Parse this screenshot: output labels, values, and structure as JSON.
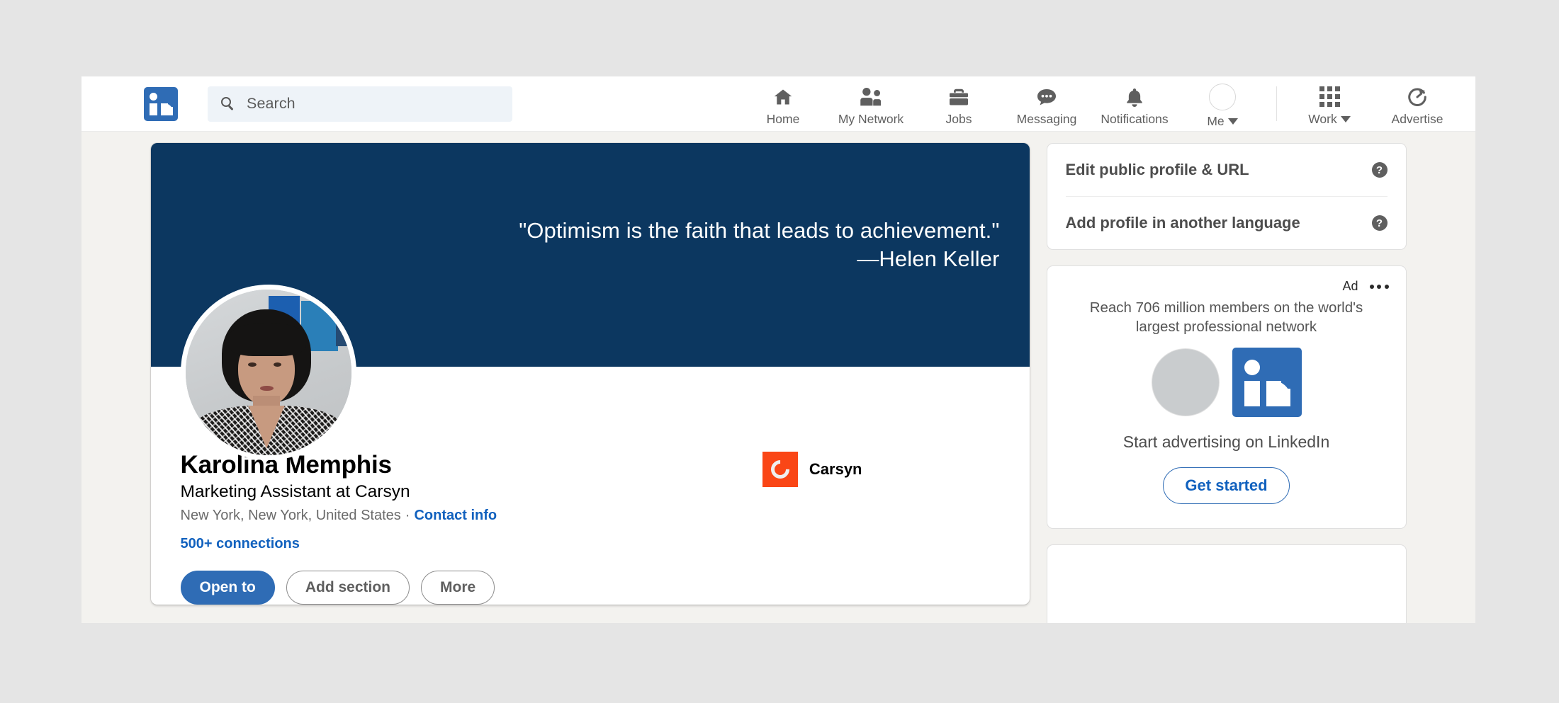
{
  "nav": {
    "logo_icon": "linkedin-logo-icon",
    "search": {
      "icon": "search-icon",
      "placeholder": "Search",
      "value": ""
    },
    "items": [
      {
        "label": "Home",
        "icon": "home-icon"
      },
      {
        "label": "My Network",
        "icon": "people-icon"
      },
      {
        "label": "Jobs",
        "icon": "briefcase-icon"
      },
      {
        "label": "Messaging",
        "icon": "chat-bubble-icon"
      },
      {
        "label": "Notifications",
        "icon": "bell-icon"
      },
      {
        "label": "Me",
        "icon": "avatar-icon",
        "caret": true
      }
    ],
    "secondary_items": [
      {
        "label": "Work",
        "icon": "grid-icon",
        "caret": true
      },
      {
        "label": "Advertise",
        "icon": "advertise-icon"
      }
    ]
  },
  "profile": {
    "banner": {
      "quote": "\"Optimism is the faith that leads to achievement.\"\n—Helen Keller",
      "background_color": "#0c3760"
    },
    "name": "Karolina Memphis",
    "headline": "Marketing Assistant at Carsyn",
    "location": "New York, New York, United States",
    "separator": "·",
    "contact_info_link": "Contact info",
    "connections": "500+ connections",
    "buttons": [
      {
        "label": "Open to",
        "style": "primary"
      },
      {
        "label": "Add section",
        "style": "outline"
      },
      {
        "label": "More",
        "style": "outline"
      }
    ],
    "company": {
      "name": "Carsyn",
      "logo_letter": "C",
      "logo_color": "#fa4616"
    }
  },
  "sidebar": {
    "links_card": {
      "rows": [
        {
          "label": "Edit public profile & URL",
          "help_icon": "help-icon",
          "help_glyph": "?"
        },
        {
          "label": "Add profile in another language",
          "help_icon": "help-icon",
          "help_glyph": "?"
        }
      ]
    },
    "ad_card": {
      "ad_label": "Ad",
      "menu_icon": "more-options-icon",
      "headline": "Reach 706 million members on the world's largest professional network",
      "cta_text": "Start advertising on LinkedIn",
      "cta_button": "Get started"
    }
  }
}
